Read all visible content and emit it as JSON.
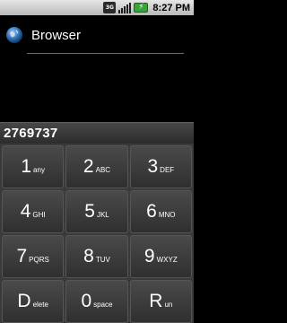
{
  "status_bar": {
    "network_label": "3G",
    "time": "8:27 PM",
    "battery_glyph": "⚡"
  },
  "header": {
    "title": "Browser",
    "icon": "globe-icon"
  },
  "input": {
    "value": "2769737"
  },
  "keypad": {
    "keys": [
      {
        "digit": "1",
        "sub": "any"
      },
      {
        "digit": "2",
        "sub": "ABC"
      },
      {
        "digit": "3",
        "sub": "DEF"
      },
      {
        "digit": "4",
        "sub": "GHI"
      },
      {
        "digit": "5",
        "sub": "JKL"
      },
      {
        "digit": "6",
        "sub": "MNO"
      },
      {
        "digit": "7",
        "sub": "PQRS"
      },
      {
        "digit": "8",
        "sub": "TUV"
      },
      {
        "digit": "9",
        "sub": "WXYZ"
      },
      {
        "digit": "D",
        "sub": "elete"
      },
      {
        "digit": "0",
        "sub": "space"
      },
      {
        "digit": "R",
        "sub": "un"
      }
    ]
  }
}
